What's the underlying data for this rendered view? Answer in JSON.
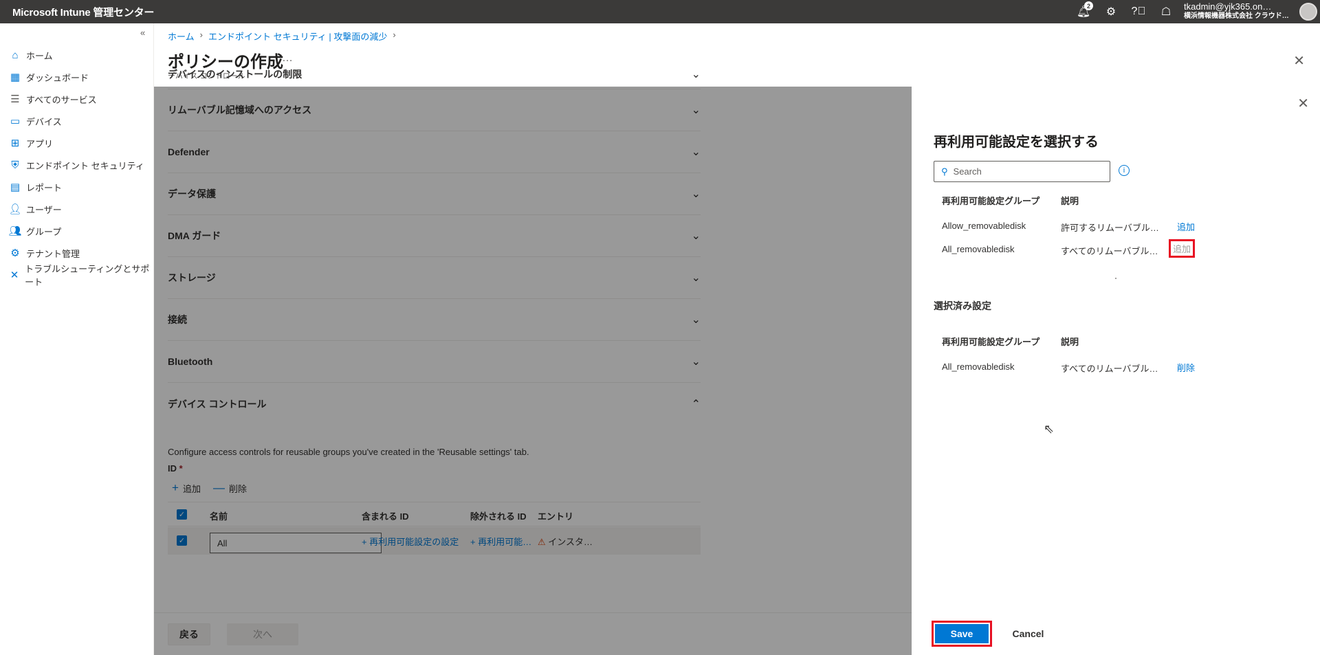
{
  "topbar": {
    "brand": "Microsoft Intune 管理センター",
    "notification_count": "2",
    "user_name": "tkadmin@yjk365.on…",
    "user_org": "横浜情報機器株式会社 クラウド…"
  },
  "sidebar": {
    "collapse_label": "«",
    "items": [
      {
        "label": "ホーム"
      },
      {
        "label": "ダッシュボード"
      },
      {
        "label": "すべてのサービス"
      },
      {
        "label": "デバイス"
      },
      {
        "label": "アプリ"
      },
      {
        "label": "エンドポイント セキュリティ"
      },
      {
        "label": "レポート"
      },
      {
        "label": "ユーザー"
      },
      {
        "label": "グループ"
      },
      {
        "label": "テナント管理"
      },
      {
        "label": "トラブルシューティングとサポート"
      }
    ]
  },
  "breadcrumb": [
    "ホーム",
    "エンドポイント セキュリティ | 攻撃面の減少"
  ],
  "page": {
    "title": "ポリシーの作成",
    "more": "…",
    "subtitle": "デバイス コントロール"
  },
  "sections": [
    "デバイスのインストールの制限",
    "リムーバブル記憶域へのアクセス",
    "Defender",
    "データ保護",
    "DMA ガード",
    "ストレージ",
    "接続",
    "Bluetooth",
    "デバイス コントロール"
  ],
  "device_control": {
    "description": "Configure access controls for reusable groups you've created in the 'Reusable settings' tab.",
    "id_label": "ID",
    "required_mark": "*",
    "add_label": "追加",
    "delete_label": "削除",
    "columns": [
      "名前",
      "含まれる ID",
      "除外される ID",
      "エントリ"
    ],
    "row": {
      "name": "All",
      "included": "+ 再利用可能設定の設定",
      "excluded": "+ 再利用可能設…",
      "entry": "インスタンス の"
    }
  },
  "footer": {
    "back": "戻る",
    "next": "次へ"
  },
  "panel": {
    "title": "再利用可能設定を選択する",
    "search_placeholder": "Search",
    "col_group": "再利用可能設定グループ",
    "col_desc": "説明",
    "available": [
      {
        "group": "Allow_removabledisk",
        "desc": "許可するリムーバブル…",
        "action": "追加"
      },
      {
        "group": "All_removabledisk",
        "desc": "すべてのリムーバブル…",
        "action": "追加"
      }
    ],
    "selected_title": "選択済み設定",
    "selected": [
      {
        "group": "All_removabledisk",
        "desc": "すべてのリムーバブル…",
        "action": "削除"
      }
    ],
    "save": "Save",
    "cancel": "Cancel"
  }
}
